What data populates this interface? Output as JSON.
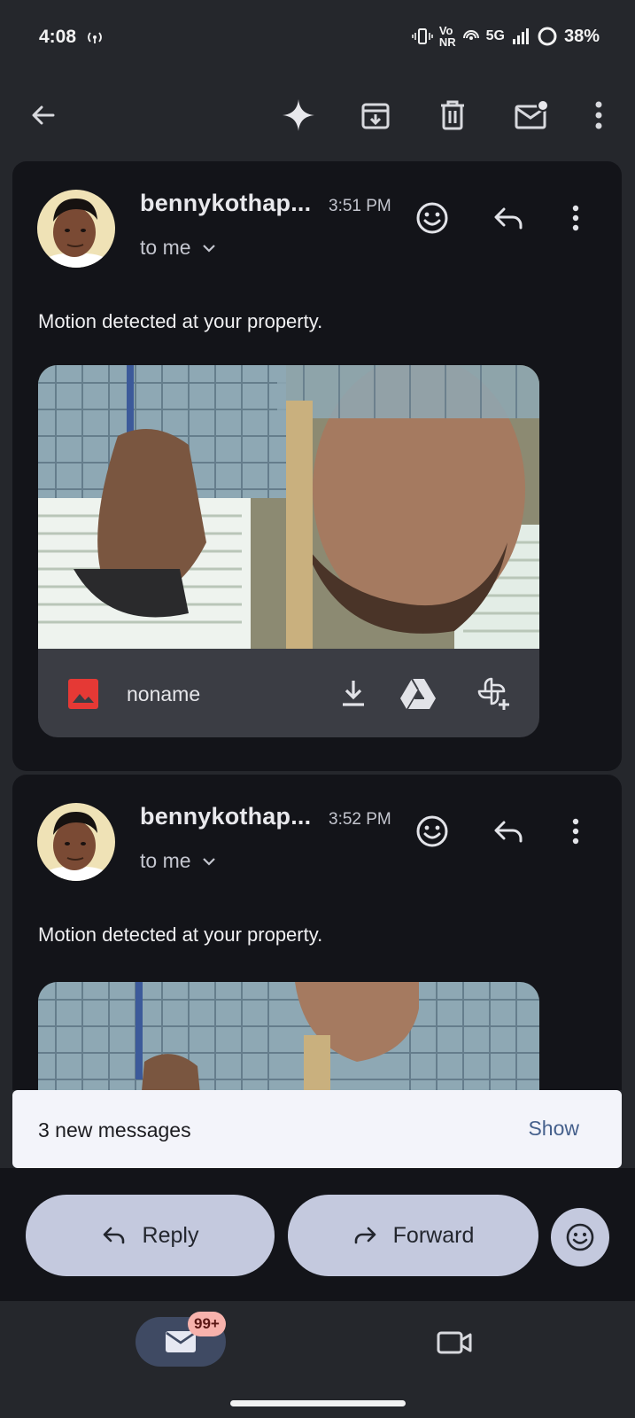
{
  "status_bar": {
    "time": "4:08",
    "network_label": "5G",
    "volte_label_top": "Vo",
    "volte_label_bottom": "NR",
    "battery": "38%"
  },
  "toolbar": {
    "icons": [
      "back-arrow-icon",
      "sparkle-icon",
      "archive-icon",
      "delete-icon",
      "mark-unread-icon",
      "more-vert-icon"
    ]
  },
  "messages": [
    {
      "sender": "bennykothap...",
      "time": "3:51 PM",
      "recipient": "to me",
      "body": "Motion detected at your property.",
      "attachment": {
        "name": "noname"
      }
    },
    {
      "sender": "bennykothap...",
      "time": "3:52 PM",
      "recipient": "to me",
      "body": "Motion detected at your property."
    }
  ],
  "snackbar": {
    "text": "3 new messages",
    "action": "Show"
  },
  "actions": {
    "reply": "Reply",
    "forward": "Forward"
  },
  "bottom_nav": {
    "mail_badge": "99+"
  },
  "colors": {
    "background": "#25272c",
    "card": "#131419",
    "pill": "#c4c9de",
    "snackbar": "#f3f4fa",
    "badge": "#f7b2ac",
    "image_attachment_red": "#e53935"
  }
}
